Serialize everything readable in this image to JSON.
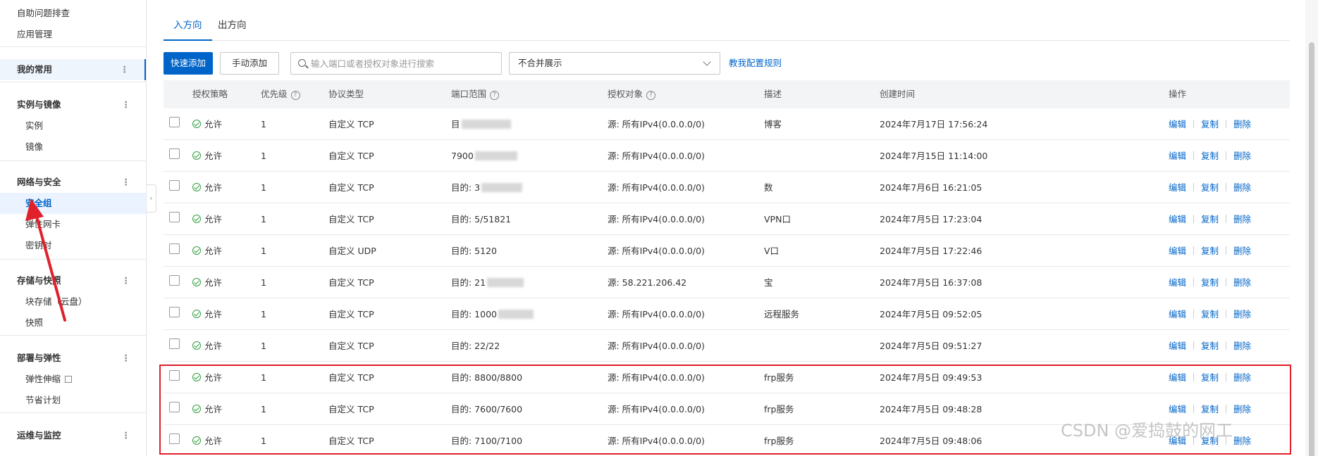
{
  "sidebar": {
    "items": [
      {
        "label": "自助问题排查",
        "type": "item"
      },
      {
        "label": "应用管理",
        "type": "item"
      },
      {
        "label": "我的常用",
        "type": "group"
      },
      {
        "label": "实例与镜像",
        "type": "group"
      },
      {
        "label": "实例",
        "type": "sub"
      },
      {
        "label": "镜像",
        "type": "sub"
      },
      {
        "label": "网络与安全",
        "type": "group"
      },
      {
        "label": "安全组",
        "type": "sub",
        "active": true
      },
      {
        "label": "弹性网卡",
        "type": "sub"
      },
      {
        "label": "密钥对",
        "type": "sub"
      },
      {
        "label": "存储与快照",
        "type": "group"
      },
      {
        "label": "块存储（云盘）",
        "type": "sub"
      },
      {
        "label": "快照",
        "type": "sub"
      },
      {
        "label": "部署与弹性",
        "type": "group"
      },
      {
        "label": "弹性伸缩",
        "type": "sub"
      },
      {
        "label": "节省计划",
        "type": "sub"
      },
      {
        "label": "运维与监控",
        "type": "group"
      }
    ],
    "dots": "⋮"
  },
  "tabs": [
    {
      "label": "入方向",
      "active": true
    },
    {
      "label": "出方向",
      "active": false
    }
  ],
  "toolbar": {
    "quick_add": "快速添加",
    "manual_add": "手动添加",
    "search_placeholder": "输入端口或者授权对象进行搜索",
    "select_value": "不合并展示",
    "help_link": "教我配置规则"
  },
  "table": {
    "headers": [
      "授权策略",
      "优先级",
      "协议类型",
      "端口范围",
      "授权对象",
      "描述",
      "创建时间",
      "操作"
    ],
    "rows": [
      {
        "policy": "允许",
        "priority": "1",
        "protocol": "自定义 TCP",
        "port": "目",
        "source": "源: 所有IPv4(0.0.0.0/0)",
        "desc": "博客",
        "created": "2024年7月17日 17:56:24"
      },
      {
        "policy": "允许",
        "priority": "1",
        "protocol": "自定义 TCP",
        "port": "7900",
        "source": "源: 所有IPv4(0.0.0.0/0)",
        "desc": "",
        "created": "2024年7月15日 11:14:00"
      },
      {
        "policy": "允许",
        "priority": "1",
        "protocol": "自定义 TCP",
        "port": "目的: 3",
        "source": "源: 所有IPv4(0.0.0.0/0)",
        "desc": "数",
        "created": "2024年7月6日 16:21:05"
      },
      {
        "policy": "允许",
        "priority": "1",
        "protocol": "自定义 TCP",
        "port": "目的: 5/51821",
        "source": "源: 所有IPv4(0.0.0.0/0)",
        "desc": "VPN口",
        "created": "2024年7月5日 17:23:04"
      },
      {
        "policy": "允许",
        "priority": "1",
        "protocol": "自定义 UDP",
        "port": "目的: 5120",
        "source": "源: 所有IPv4(0.0.0.0/0)",
        "desc": "V口",
        "created": "2024年7月5日 17:22:46"
      },
      {
        "policy": "允许",
        "priority": "1",
        "protocol": "自定义 TCP",
        "port": "目的: 21",
        "source": "源: 58.221.206.42",
        "desc": "宝",
        "created": "2024年7月5日 16:37:08"
      },
      {
        "policy": "允许",
        "priority": "1",
        "protocol": "自定义 TCP",
        "port": "目的: 1000",
        "source": "源: 所有IPv4(0.0.0.0/0)",
        "desc": "远程服务",
        "created": "2024年7月5日 09:52:05"
      },
      {
        "policy": "允许",
        "priority": "1",
        "protocol": "自定义 TCP",
        "port": "目的: 22/22",
        "source": "源: 所有IPv4(0.0.0.0/0)",
        "desc": "",
        "created": "2024年7月5日 09:51:27"
      },
      {
        "policy": "允许",
        "priority": "1",
        "protocol": "自定义 TCP",
        "port": "目的: 8800/8800",
        "source": "源: 所有IPv4(0.0.0.0/0)",
        "desc": "frp服务",
        "created": "2024年7月5日 09:49:53"
      },
      {
        "policy": "允许",
        "priority": "1",
        "protocol": "自定义 TCP",
        "port": "目的: 7600/7600",
        "source": "源: 所有IPv4(0.0.0.0/0)",
        "desc": "frp服务",
        "created": "2024年7月5日 09:48:28"
      },
      {
        "policy": "允许",
        "priority": "1",
        "protocol": "自定义 TCP",
        "port": "目的: 7100/7100",
        "source": "源: 所有IPv4(0.0.0.0/0)",
        "desc": "frp服务",
        "created": "2024年7月5日 09:48:06"
      }
    ],
    "actions": [
      "编辑",
      "复制",
      "删除"
    ]
  },
  "watermark": "CSDN @爱捣鼓的网工",
  "colors": {
    "accent": "#0064c8",
    "annotation": "#e0202a",
    "allow": "#2e9f3c"
  }
}
